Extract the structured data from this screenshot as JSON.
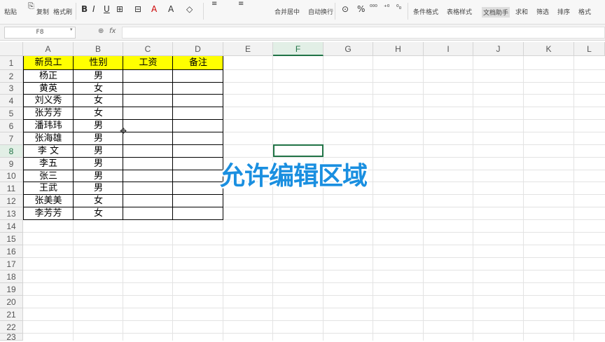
{
  "toolbar": {
    "paste_label": "粘贴",
    "copy_label": "复制",
    "format_painter_label": "格式刷",
    "merge_center_label": "合并居中",
    "auto_wrap_label": "自动换行",
    "conditional_format_label": "条件格式",
    "table_style_label": "表格样式",
    "doc_assistant_label": "文档助手",
    "sum_label": "求和",
    "filter_label": "筛选",
    "sort_label": "排序",
    "format_label": "格式"
  },
  "formula_bar": {
    "name_box": "F8",
    "fx_label": "fx",
    "formula": ""
  },
  "columns": [
    "A",
    "B",
    "C",
    "D",
    "E",
    "F",
    "G",
    "H",
    "I",
    "J",
    "K",
    "L"
  ],
  "selected_column": "F",
  "rows": [
    "1",
    "2",
    "3",
    "4",
    "5",
    "6",
    "7",
    "8",
    "9",
    "10",
    "11",
    "12",
    "13",
    "14",
    "15",
    "16",
    "17",
    "18",
    "19",
    "20",
    "21",
    "22",
    "23"
  ],
  "selected_row": "8",
  "table": {
    "headers": [
      "新员工",
      "性别",
      "工资",
      "备注"
    ],
    "rows": [
      [
        "杨正",
        "男"
      ],
      [
        "黄英",
        "女"
      ],
      [
        "刘义秀",
        "女"
      ],
      [
        "张芳芳",
        "女"
      ],
      [
        "潘玮玮",
        "男"
      ],
      [
        "张海雄",
        "男"
      ],
      [
        "李  文",
        "男"
      ],
      [
        "李五",
        "男"
      ],
      [
        "张三",
        "男"
      ],
      [
        "王武",
        "男"
      ],
      [
        "张美美",
        "女"
      ],
      [
        "李芳芳",
        "女"
      ]
    ]
  },
  "overlay_caption": "允许编辑区域",
  "colors": {
    "header_fill": "#ffff00",
    "overlay_text": "#1a8fe0",
    "selection": "#217346"
  }
}
